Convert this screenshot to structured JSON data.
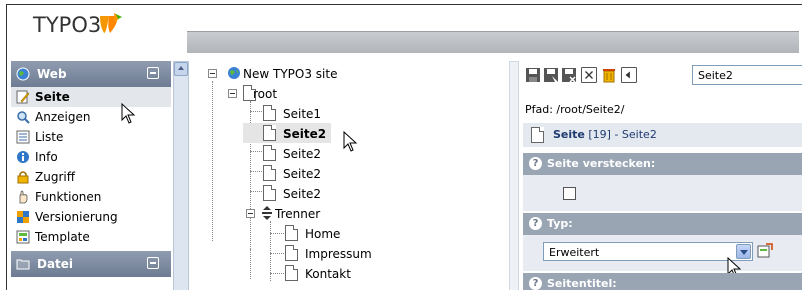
{
  "header": {
    "logo_text": "TYPO3"
  },
  "module_menu": {
    "groups": [
      {
        "label": "Web",
        "items": [
          {
            "label": "Seite",
            "icon": "pencil-page-icon",
            "active": true
          },
          {
            "label": "Anzeigen",
            "icon": "magnifier-icon"
          },
          {
            "label": "Liste",
            "icon": "list-icon"
          },
          {
            "label": "Info",
            "icon": "info-icon"
          },
          {
            "label": "Zugriff",
            "icon": "lock-icon"
          },
          {
            "label": "Funktionen",
            "icon": "hand-icon"
          },
          {
            "label": "Versionierung",
            "icon": "versioning-icon"
          },
          {
            "label": "Template",
            "icon": "template-icon"
          }
        ]
      },
      {
        "label": "Datei",
        "items": []
      }
    ]
  },
  "page_tree": {
    "site_label": "New TYPO3 site",
    "nodes": [
      {
        "label": "root"
      },
      {
        "label": "Seite1"
      },
      {
        "label": "Seite2",
        "selected": true
      },
      {
        "label": "Seite2"
      },
      {
        "label": "Seite2"
      },
      {
        "label": "Seite2"
      },
      {
        "label": "Trenner"
      },
      {
        "label": "Home"
      },
      {
        "label": "Impressum"
      },
      {
        "label": "Kontakt"
      }
    ]
  },
  "edit_panel": {
    "page_selector_value": "Seite2",
    "path": "Pfad: /root/Seite2/",
    "page_header": {
      "type": "Seite",
      "id": "[19]",
      "title": "- Seite2"
    },
    "sections": {
      "hide_page": {
        "label": "Seite verstecken:",
        "checked": false
      },
      "type": {
        "label": "Typ:",
        "value": "Erweitert"
      },
      "page_title": {
        "label": "Seitentitel:"
      }
    },
    "help_icon": "?"
  }
}
